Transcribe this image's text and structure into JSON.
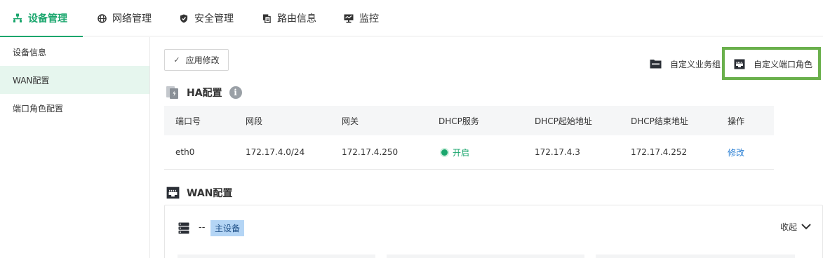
{
  "nav": {
    "tabs": [
      {
        "label": "设备管理",
        "icon": "network-device-icon",
        "active": true
      },
      {
        "label": "网络管理",
        "icon": "globe-icon",
        "active": false
      },
      {
        "label": "安全管理",
        "icon": "shield-icon",
        "active": false
      },
      {
        "label": "路由信息",
        "icon": "route-copy-icon",
        "active": false
      },
      {
        "label": "监控",
        "icon": "monitor-icon",
        "active": false
      }
    ]
  },
  "sidebar": {
    "items": [
      {
        "label": "设备信息",
        "active": false
      },
      {
        "label": "WAN配置",
        "active": true
      },
      {
        "label": "端口角色配置",
        "active": false
      }
    ]
  },
  "toolbar": {
    "apply_label": "应用修改",
    "custom_business_group": "自定义业务组",
    "custom_port_role": "自定义端口角色"
  },
  "ha": {
    "title": "HA配置",
    "columns": [
      "端口号",
      "网段",
      "网关",
      "DHCP服务",
      "DHCP起始地址",
      "DHCP结束地址",
      "操作"
    ],
    "rows": [
      {
        "port": "eth0",
        "subnet": "172.17.4.0/24",
        "gateway": "172.17.4.250",
        "dhcp": "开启",
        "start": "172.17.4.3",
        "end": "172.17.4.252",
        "action": "修改"
      }
    ]
  },
  "wan": {
    "title": "WAN配置",
    "device_name": "--",
    "device_badge": "主设备",
    "collapse_label": "收起"
  },
  "colors": {
    "accent": "#1aa66d",
    "active_bg": "#e6f6ee",
    "link": "#2a7fd4",
    "highlight": "#6ab04c",
    "badge_bg": "#b4d5f5"
  }
}
